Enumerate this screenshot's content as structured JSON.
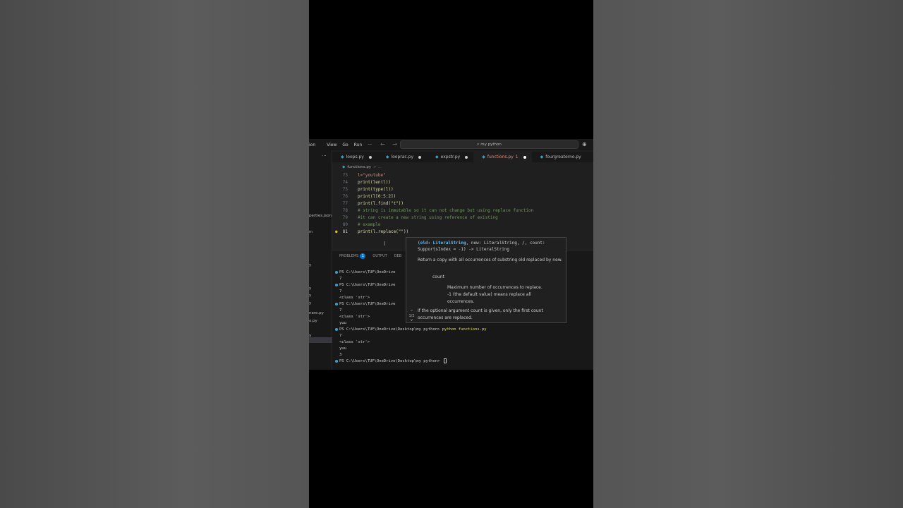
{
  "titlebar": {
    "menus": [
      "ion",
      "View",
      "Go",
      "Run",
      "···"
    ],
    "nav_arrows": "← →",
    "search_text": "my python"
  },
  "sidebar": {
    "more": "···",
    "items": [
      "perties.json",
      "ın",
      "y",
      "y",
      "y",
      "y",
      "nere.py",
      "o.py",
      "y"
    ]
  },
  "tabs": [
    {
      "label": "loops.py",
      "modified": true
    },
    {
      "label": "looprac.py",
      "modified": true
    },
    {
      "label": "expstr.py",
      "modified": true
    },
    {
      "label": "functions.py",
      "errors": "1",
      "modified": true,
      "active": true
    },
    {
      "label": "fourgreaterno.py",
      "modified": false
    },
    {
      "label": "n",
      "modified": false
    }
  ],
  "breadcrumb": {
    "file": "functions.py",
    "rest": "> ..."
  },
  "editor": {
    "lines": [
      {
        "num": "73",
        "code": "l=\"youtube\""
      },
      {
        "num": "74",
        "code": "print(len(l))"
      },
      {
        "num": "75",
        "code": "print(type(l))"
      },
      {
        "num": "76",
        "code": "print(l[0:5:2])"
      },
      {
        "num": "77",
        "code": "print(l.find(\"t\"))"
      },
      {
        "num": "78",
        "code": "# string is immutable so it can not change but using replace function"
      },
      {
        "num": "79",
        "code": "#it can create a new string using reference of existing"
      },
      {
        "num": "80",
        "code": "# example"
      },
      {
        "num": "81",
        "code": "print(l.replace(\"\"))"
      }
    ]
  },
  "panel": {
    "tabs": [
      "PROBLEMS",
      "OUTPUT",
      "DEB"
    ],
    "problems_count": "1"
  },
  "terminal": {
    "lines": [
      {
        "dot": true,
        "text": "PS C:\\Users\\TUF\\OneDrive",
        "cmd": ""
      },
      {
        "dot": false,
        "text": "7",
        "cmd": ""
      },
      {
        "dot": true,
        "text": "PS C:\\Users\\TUF\\OneDrive",
        "cmd": ""
      },
      {
        "dot": false,
        "text": "7",
        "cmd": ""
      },
      {
        "dot": false,
        "text": "<class 'str'>",
        "cmd": ""
      },
      {
        "dot": true,
        "text": "PS C:\\Users\\TUF\\OneDrive",
        "cmd": ""
      },
      {
        "dot": false,
        "text": "7",
        "cmd": ""
      },
      {
        "dot": false,
        "text": "<class 'str'>",
        "cmd": ""
      },
      {
        "dot": false,
        "text": "yuu",
        "cmd": ""
      },
      {
        "dot": true,
        "text": "PS C:\\Users\\TUF\\OneDrive\\Desktop\\my python> ",
        "cmd": "python functions.py"
      },
      {
        "dot": false,
        "text": "7",
        "cmd": ""
      },
      {
        "dot": false,
        "text": "<class 'str'>",
        "cmd": ""
      },
      {
        "dot": false,
        "text": "yuu",
        "cmd": ""
      },
      {
        "dot": false,
        "text": "3",
        "cmd": ""
      },
      {
        "dot": true,
        "text": "PS C:\\Users\\TUF\\OneDrive\\Desktop\\my python> ",
        "cmd": ""
      }
    ]
  },
  "tooltip": {
    "sig_param": "(old: LiteralString",
    "sig_rest1": ", new: LiteralString, /, count:",
    "sig_rest2": "SupportsIndex = -1) -> LiteralString",
    "description": "Return a copy with all occurrences of substring old replaced by new.",
    "count_label": "count",
    "count_desc1": "Maximum number of occurrences to replace.",
    "count_desc2": "-1 (the default value) means replace all occurrences.",
    "note": "If the optional argument count is given, only the first count occurrences are replaced.",
    "pager_up": "^",
    "pager_text": "1/2",
    "pager_down": "v"
  },
  "colors": {
    "editor_bg": "#1f1f1f",
    "accent": "#0078d4",
    "error": "#f48771",
    "python_icon": "#3aa0c8"
  }
}
